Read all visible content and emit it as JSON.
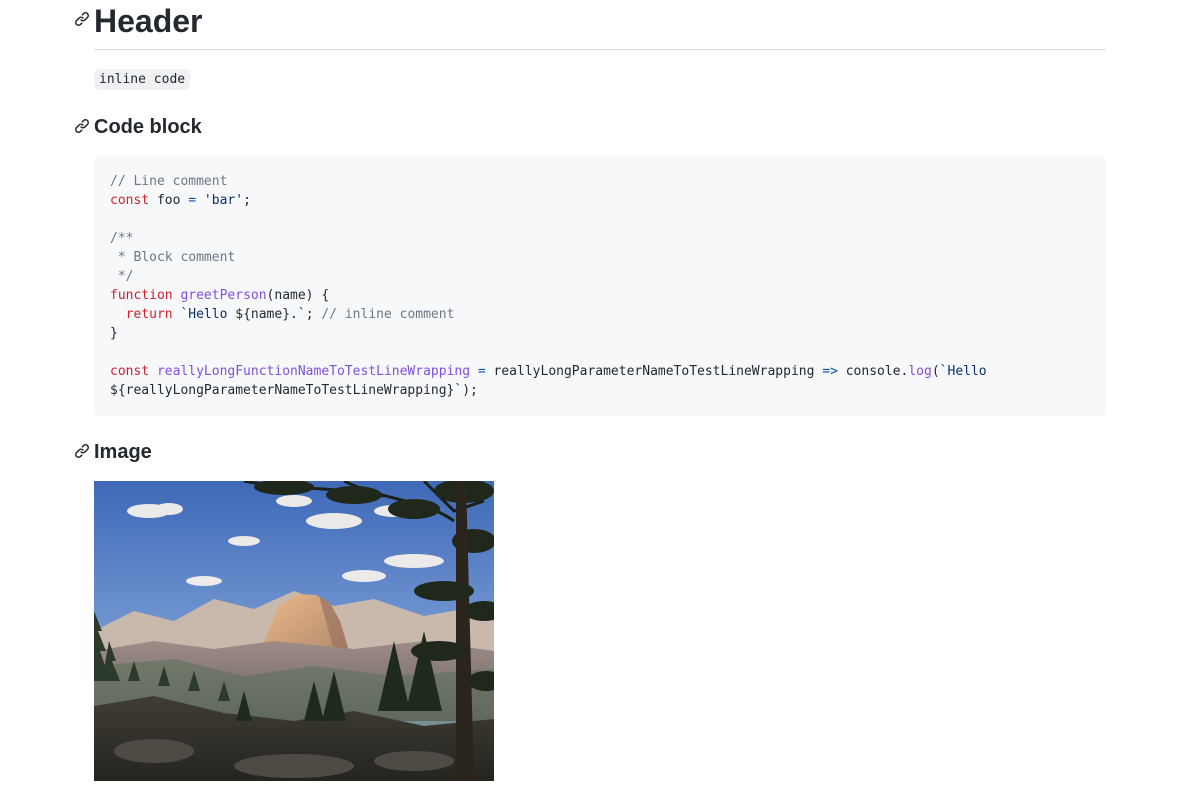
{
  "headings": {
    "h1": "Header",
    "code_block": "Code block",
    "image": "Image"
  },
  "inline_code": "inline code",
  "code": {
    "line1_comment": "// Line comment",
    "line2_kw": "const",
    "line2_name": " foo ",
    "line2_op": "=",
    "line2_str": " 'bar'",
    "line2_end": ";",
    "line4": "/**",
    "line5": " * Block comment",
    "line6": " */",
    "line7_kw": "function",
    "line7_fn": " greetPerson",
    "line7_rest": "(name) {",
    "line8_indent": "  ",
    "line8_kw": "return",
    "line8_str1": " `Hello ",
    "line8_interp": "${name}",
    "line8_str2": ".`",
    "line8_end": "; ",
    "line8_comment": "// inline comment",
    "line9": "}",
    "line11_kw": "const",
    "line11_fn": " reallyLongFunctionNameToTestLineWrapping",
    "line11_op1": " =",
    "line11_param": " reallyLongParameterNameToTestLineWrapping ",
    "line11_op2": "=>",
    "line11_console": " console.",
    "line11_log": "log",
    "line11_paren": "(",
    "line11_str": "`Hello",
    "line12_interp": "${reallyLongParameterNameToTestLineWrapping}",
    "line12_str": "`",
    "line12_end": ");"
  },
  "icons": {
    "anchor": "link-icon"
  },
  "colors": {
    "code_bg": "#f6f8fa",
    "comment": "#6e7781",
    "keyword": "#cf222e",
    "function": "#8250df",
    "string": "#0a3069",
    "operator": "#0550ae"
  }
}
